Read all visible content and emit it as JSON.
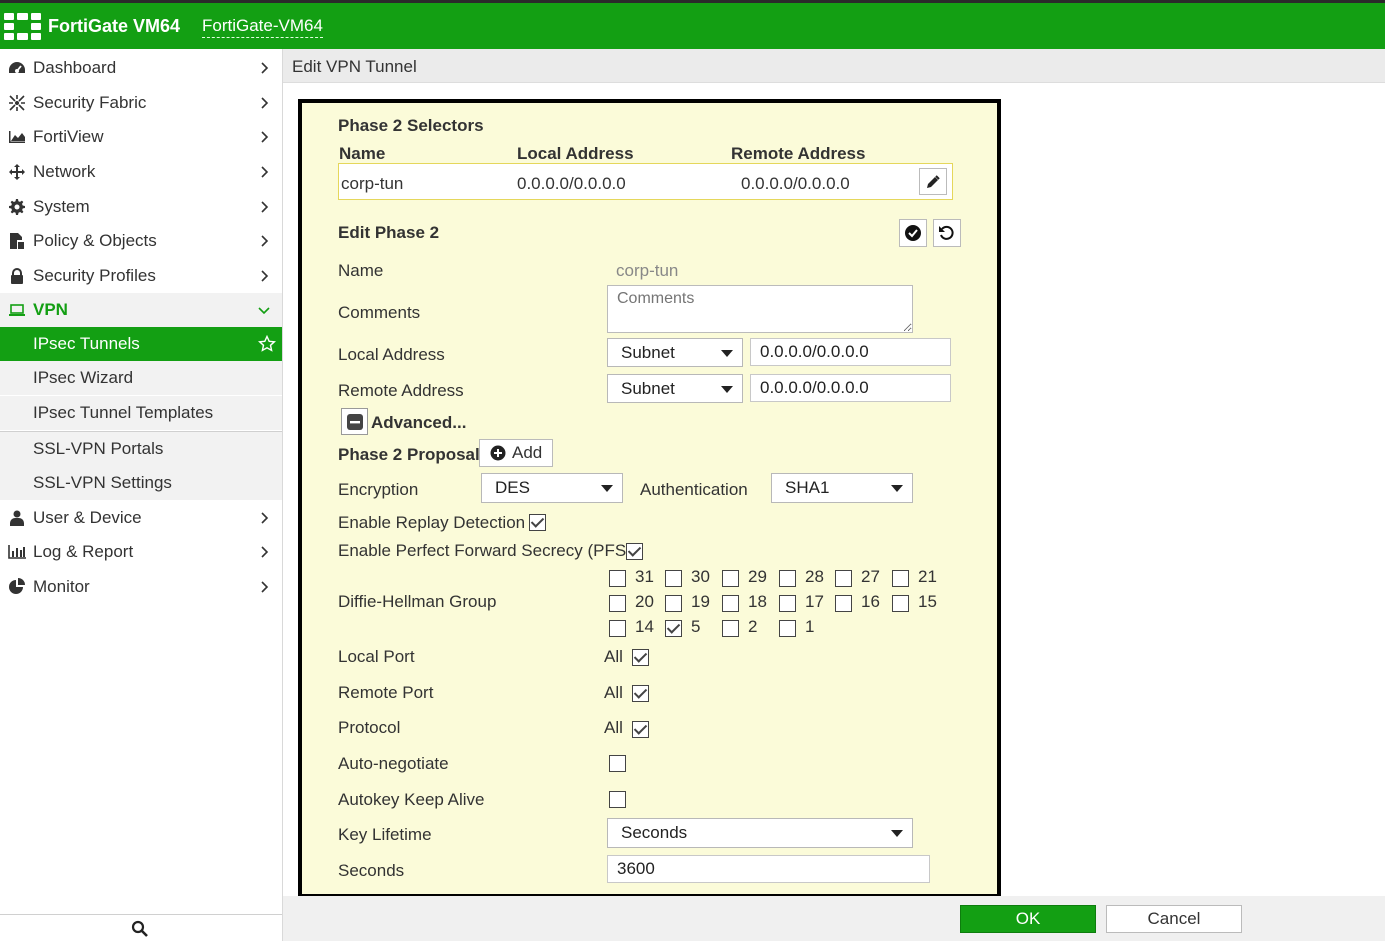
{
  "app": {
    "brand": "FortiGate VM64",
    "hostname": "FortiGate-VM64"
  },
  "sidebar": {
    "items": [
      {
        "label": "Dashboard",
        "icon": "dashboard-icon"
      },
      {
        "label": "Security Fabric",
        "icon": "security-fabric-icon"
      },
      {
        "label": "FortiView",
        "icon": "fortiview-icon"
      },
      {
        "label": "Network",
        "icon": "network-icon"
      },
      {
        "label": "System",
        "icon": "gear-icon"
      },
      {
        "label": "Policy & Objects",
        "icon": "policy-icon"
      },
      {
        "label": "Security Profiles",
        "icon": "lock-icon"
      },
      {
        "label": "VPN",
        "icon": "laptop-icon"
      }
    ],
    "vpn_sub": [
      "IPsec Tunnels",
      "IPsec Wizard",
      "IPsec Tunnel Templates",
      "SSL-VPN Portals",
      "SSL-VPN Settings"
    ],
    "items_after": [
      {
        "label": "User & Device",
        "icon": "user-icon"
      },
      {
        "label": "Log & Report",
        "icon": "chart-icon"
      },
      {
        "label": "Monitor",
        "icon": "pie-icon"
      }
    ]
  },
  "page": {
    "title": "Edit VPN Tunnel"
  },
  "selectors": {
    "heading": "Phase 2 Selectors",
    "columns": [
      "Name",
      "Local Address",
      "Remote Address"
    ],
    "row": {
      "name": "corp-tun",
      "local": "0.0.0.0/0.0.0.0",
      "remote": "0.0.0.0/0.0.0.0"
    }
  },
  "phase2": {
    "heading": "Edit Phase 2",
    "name_label": "Name",
    "name_value": "corp-tun",
    "comments_label": "Comments",
    "comments_placeholder": "Comments",
    "local_address_label": "Local Address",
    "local_type": "Subnet",
    "local_value": "0.0.0.0/0.0.0.0",
    "remote_address_label": "Remote Address",
    "remote_type": "Subnet",
    "remote_value": "0.0.0.0/0.0.0.0",
    "advanced_label": "Advanced...",
    "proposal_label": "Phase 2 Proposal",
    "add_label": "Add",
    "encryption_label": "Encryption",
    "encryption_value": "DES",
    "auth_label": "Authentication",
    "auth_value": "SHA1",
    "replay_label": "Enable Replay Detection",
    "pfs_label": "Enable Perfect Forward Secrecy (PFS)",
    "dh_label": "Diffie-Hellman Group",
    "dh_groups": [
      {
        "g": "31",
        "on": false
      },
      {
        "g": "30",
        "on": false
      },
      {
        "g": "29",
        "on": false
      },
      {
        "g": "28",
        "on": false
      },
      {
        "g": "27",
        "on": false
      },
      {
        "g": "21",
        "on": false
      },
      {
        "g": "20",
        "on": false
      },
      {
        "g": "19",
        "on": false
      },
      {
        "g": "18",
        "on": false
      },
      {
        "g": "17",
        "on": false
      },
      {
        "g": "16",
        "on": false
      },
      {
        "g": "15",
        "on": false
      },
      {
        "g": "14",
        "on": false
      },
      {
        "g": "5",
        "on": true
      },
      {
        "g": "2",
        "on": false
      },
      {
        "g": "1",
        "on": false
      }
    ],
    "local_port_label": "Local Port",
    "remote_port_label": "Remote Port",
    "protocol_label": "Protocol",
    "all_label": "All",
    "auto_negotiate_label": "Auto-negotiate",
    "keepalive_label": "Autokey Keep Alive",
    "key_lifetime_label": "Key Lifetime",
    "key_lifetime_value": "Seconds",
    "seconds_label": "Seconds",
    "seconds_value": "3600"
  },
  "footer": {
    "ok": "OK",
    "cancel": "Cancel"
  },
  "colors": {
    "brand_green": "#139f13",
    "form_bg": "#fbfbd9"
  }
}
